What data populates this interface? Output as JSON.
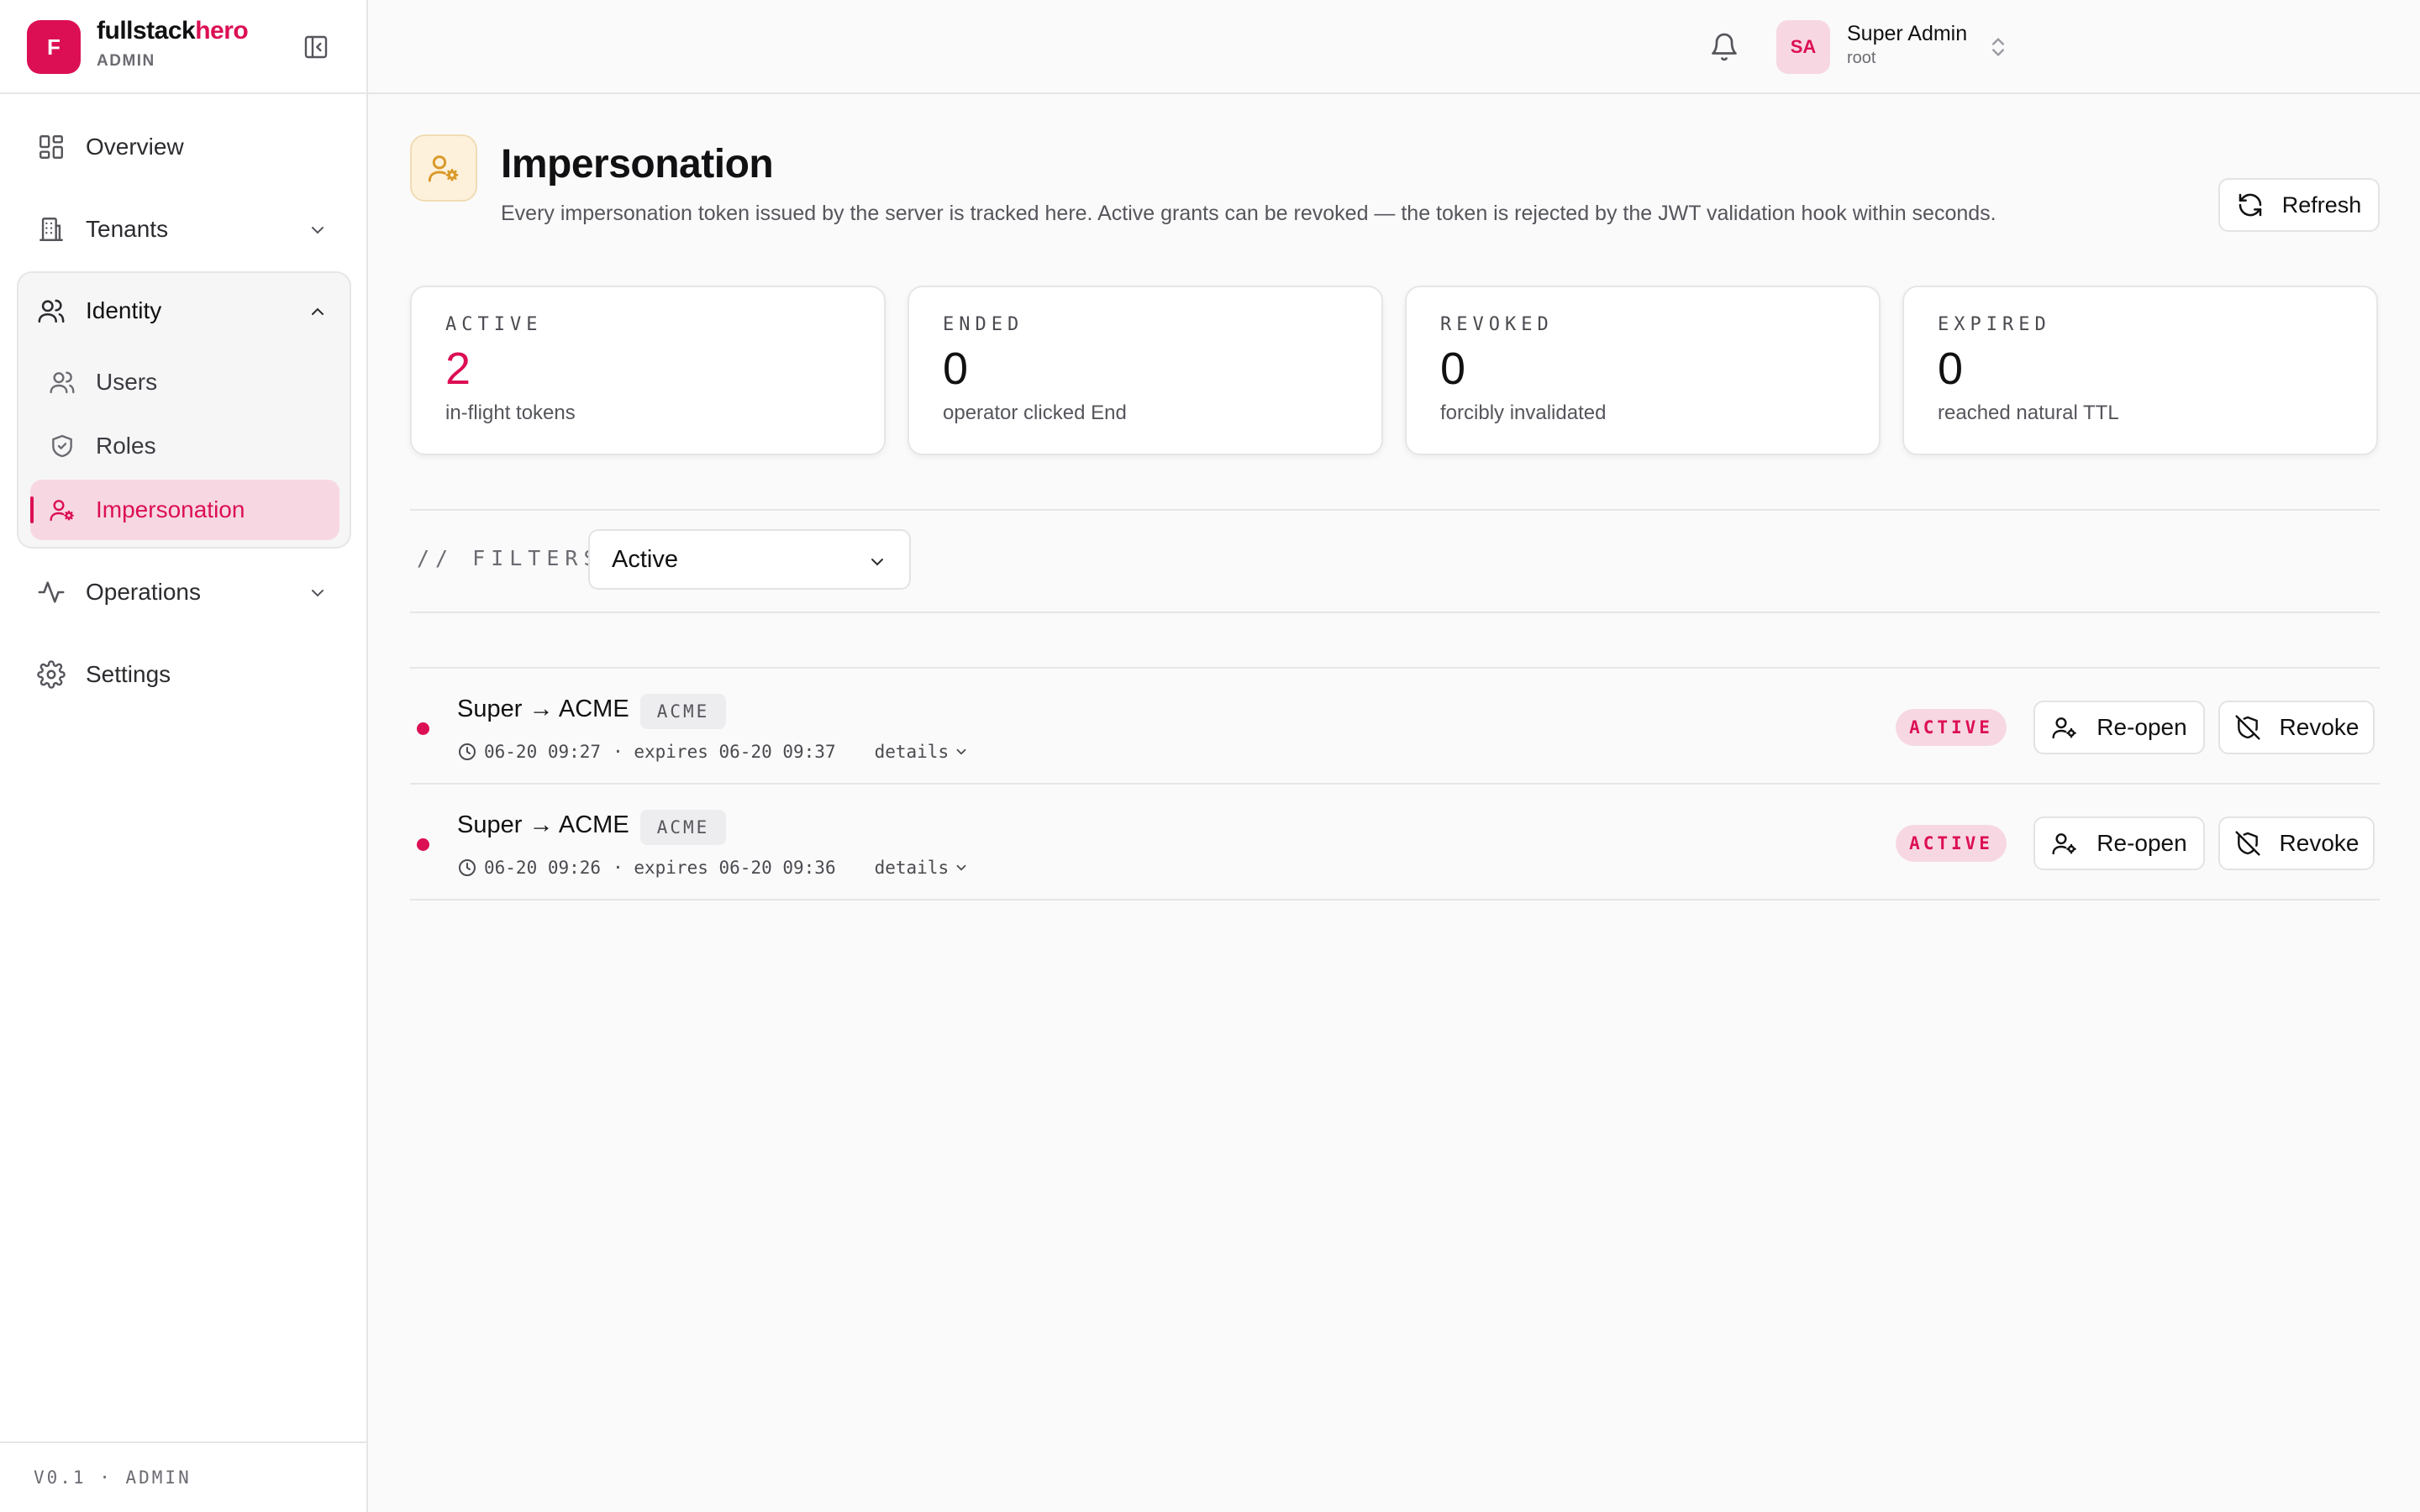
{
  "brand": {
    "logo_letter": "F",
    "name_main": "fullstack",
    "name_accent": "hero",
    "subtitle": "ADMIN"
  },
  "sidebar": {
    "items": [
      {
        "label": "Overview",
        "icon": "dashboard-icon"
      },
      {
        "label": "Tenants",
        "icon": "building-icon"
      },
      {
        "label": "Identity",
        "icon": "users-icon",
        "expanded": true,
        "children": [
          {
            "label": "Users",
            "icon": "users-icon"
          },
          {
            "label": "Roles",
            "icon": "shield-icon"
          },
          {
            "label": "Impersonation",
            "icon": "user-cog-icon",
            "active": true
          }
        ]
      },
      {
        "label": "Operations",
        "icon": "activity-icon"
      },
      {
        "label": "Settings",
        "icon": "gear-icon"
      }
    ],
    "footer": "V0.1 · ADMIN"
  },
  "topbar": {
    "user": {
      "initials": "SA",
      "name": "Super Admin",
      "role": "root"
    }
  },
  "page": {
    "title": "Impersonation",
    "description": "Every impersonation token issued by the server is tracked here. Active grants can be revoked — the token is rejected by the JWT validation hook within seconds.",
    "refresh_label": "Refresh"
  },
  "stats": [
    {
      "label": "ACTIVE",
      "value": "2",
      "note": "in-flight tokens"
    },
    {
      "label": "ENDED",
      "value": "0",
      "note": "operator clicked End"
    },
    {
      "label": "REVOKED",
      "value": "0",
      "note": "forcibly invalidated"
    },
    {
      "label": "EXPIRED",
      "value": "0",
      "note": "reached natural TTL"
    }
  ],
  "filters": {
    "label": "// FILTERS",
    "selected": "Active"
  },
  "rows": [
    {
      "title": "Super → ACME",
      "tag": "ACME",
      "started": "06-20 09:27",
      "expires": "· expires 06-20 09:37",
      "details": "details",
      "status": "ACTIVE",
      "reopen": "Re-open",
      "revoke": "Revoke"
    },
    {
      "title": "Super → ACME",
      "tag": "ACME",
      "started": "06-20 09:26",
      "expires": "· expires 06-20 09:36",
      "details": "details",
      "status": "ACTIVE",
      "reopen": "Re-open",
      "revoke": "Revoke"
    }
  ],
  "colors": {
    "accent": "#dc0f54",
    "badge_bg": "#f7d8e2",
    "page_icon_bg": "#fdf1dc",
    "page_icon_fg": "#d99a2b"
  }
}
